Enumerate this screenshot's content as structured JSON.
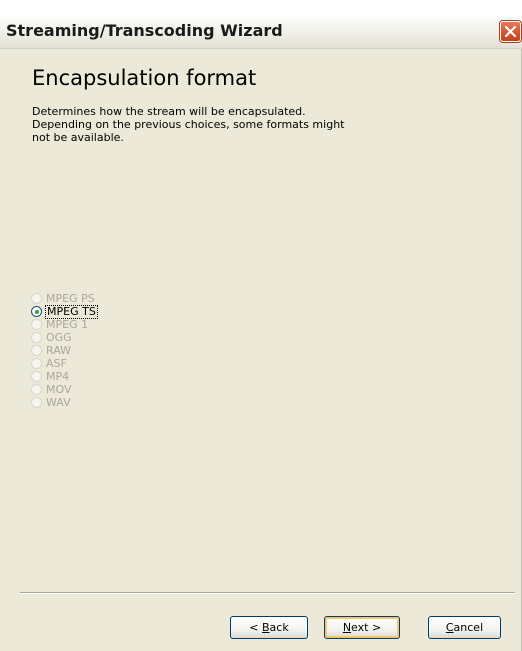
{
  "window": {
    "title": "Streaming/Transcoding Wizard"
  },
  "page": {
    "heading": "Encapsulation format",
    "description_lines": [
      "Determines how the stream will be encapsulated.",
      "Depending on the previous choices, some formats might",
      "not be available."
    ]
  },
  "formats": {
    "selected": "MPEG TS",
    "options": [
      {
        "label": "MPEG PS",
        "enabled": false,
        "checked": false
      },
      {
        "label": "MPEG TS",
        "enabled": true,
        "checked": true
      },
      {
        "label": "MPEG 1",
        "enabled": false,
        "checked": false
      },
      {
        "label": "OGG",
        "enabled": false,
        "checked": false
      },
      {
        "label": "RAW",
        "enabled": false,
        "checked": false
      },
      {
        "label": "ASF",
        "enabled": false,
        "checked": false
      },
      {
        "label": "MP4",
        "enabled": false,
        "checked": false
      },
      {
        "label": "MOV",
        "enabled": false,
        "checked": false
      },
      {
        "label": "WAV",
        "enabled": false,
        "checked": false
      }
    ]
  },
  "buttons": {
    "back": {
      "pre": "< ",
      "mnemonic": "B",
      "post": "ack"
    },
    "next": {
      "pre": "",
      "mnemonic": "N",
      "post": "ext >"
    },
    "cancel": {
      "pre": "",
      "mnemonic": "C",
      "post": "ancel"
    }
  },
  "icons": {
    "close": "close-icon"
  },
  "colors": {
    "dialog_background": "#ece9d8",
    "close_button": "#d5532f",
    "disabled_text": "#aca899",
    "button_border": "#003c74",
    "default_button_highlight": "#f4c86a",
    "radio_dot": "#3f9a35"
  }
}
